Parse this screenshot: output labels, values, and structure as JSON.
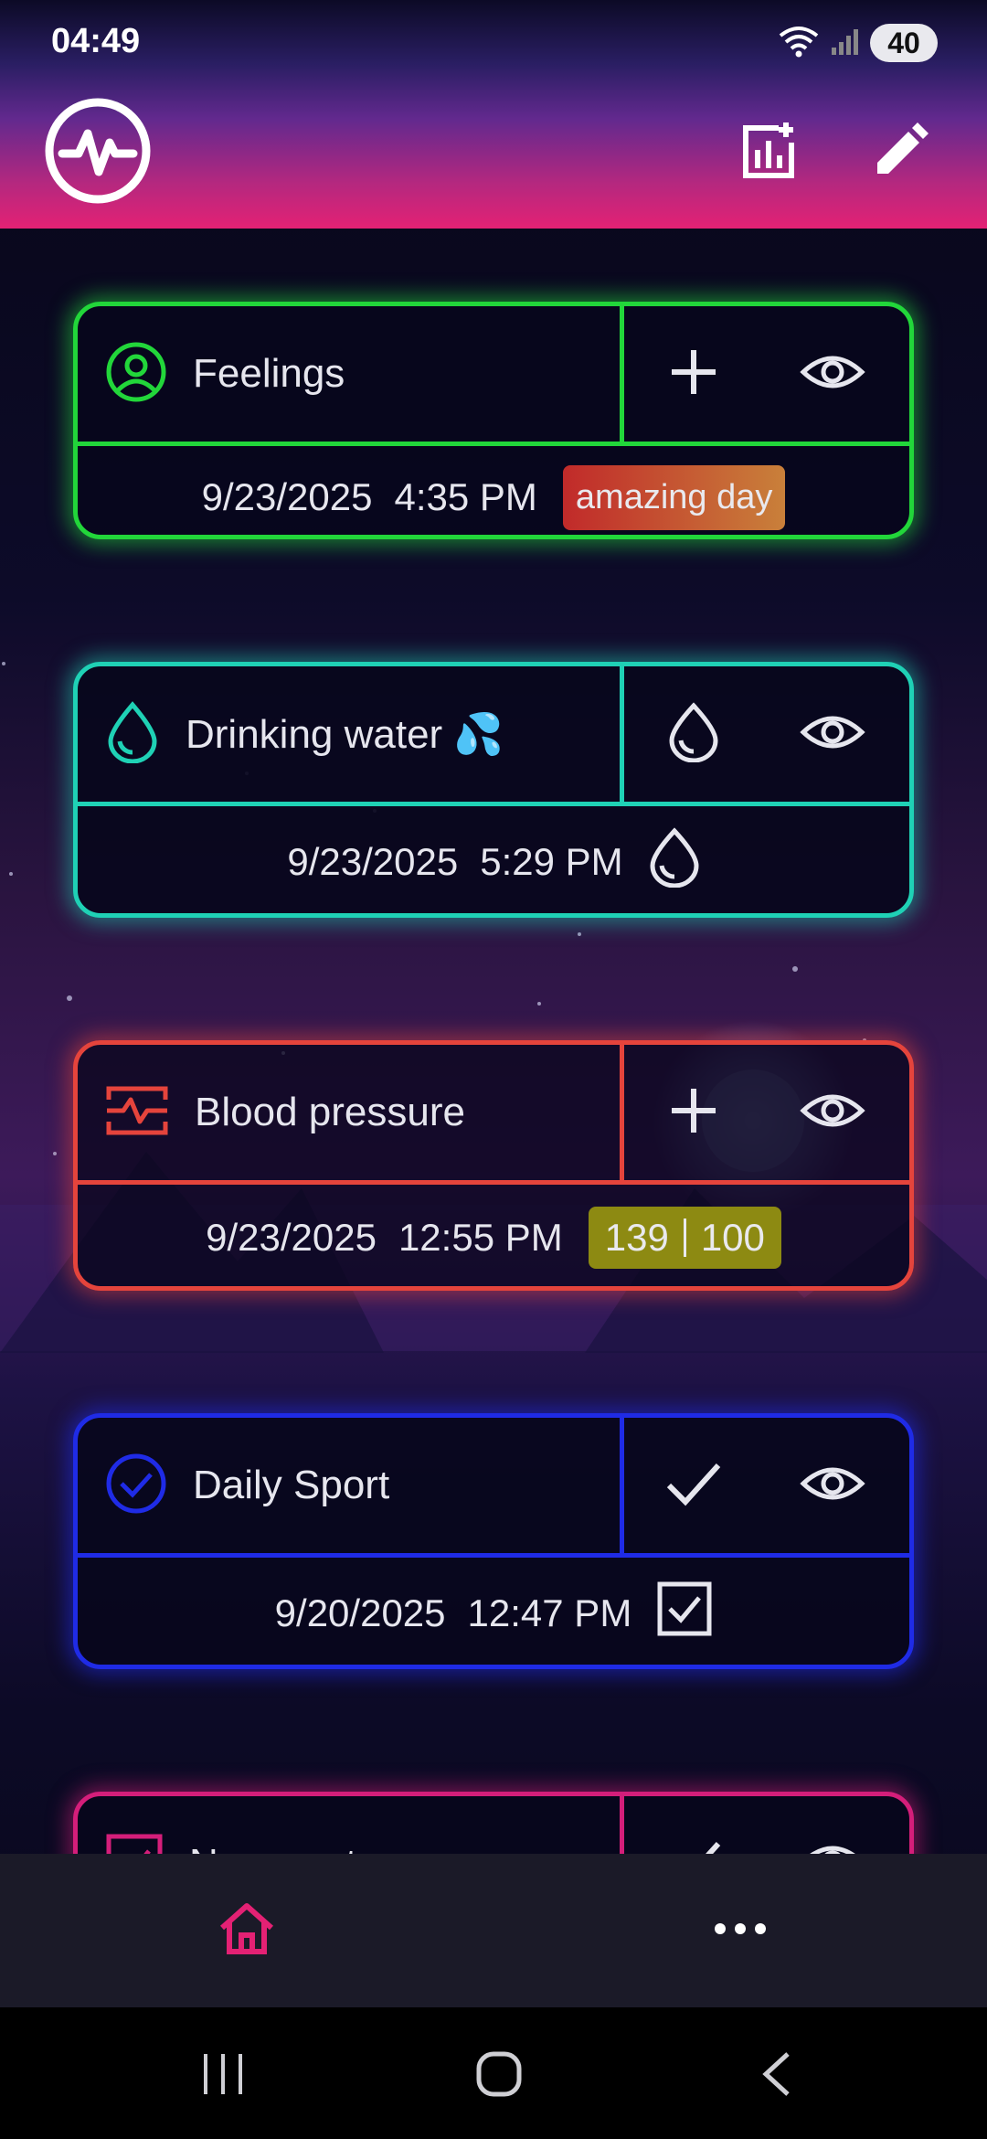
{
  "status_bar": {
    "time": "04:49",
    "battery": "40",
    "icons": [
      "wifi-icon",
      "signal-icon",
      "battery-icon"
    ]
  },
  "app_bar": {
    "logo_icon": "heartbeat-logo-icon",
    "actions": [
      "add-chart-icon",
      "edit-icon"
    ]
  },
  "trackers": [
    {
      "name": "Feelings",
      "icon": "person-circle-icon",
      "action_icon": "plus-icon",
      "view_icon": "eye-icon",
      "color": "#22d63a",
      "date": "9/23/2025",
      "time": "4:35 PM",
      "value": "amazing day"
    },
    {
      "name": "Drinking water 💦",
      "icon": "water-drop-icon",
      "action_icon": "water-drop-icon",
      "view_icon": "eye-icon",
      "color": "#1fd1b5",
      "date": "9/23/2025",
      "time": "5:29 PM",
      "value_icon": "water-drop-icon"
    },
    {
      "name": "Blood pressure",
      "icon": "monitor-heart-icon",
      "action_icon": "plus-icon",
      "view_icon": "eye-icon",
      "color": "#e5443c",
      "date": "9/23/2025",
      "time": "12:55 PM",
      "value_systolic": "139",
      "value_diastolic": "100"
    },
    {
      "name": "Daily Sport",
      "icon": "check-circle-icon",
      "action_icon": "check-icon",
      "view_icon": "eye-icon",
      "color": "#1f2be6",
      "date": "9/20/2025",
      "time": "12:47 PM",
      "value_icon": "checkbox-checked-icon"
    },
    {
      "name": "No sweets",
      "icon": "checkbox-icon",
      "action_icon": "check-icon",
      "view_icon": "eye-icon",
      "color": "#d41e7a"
    }
  ],
  "bottom_nav": {
    "items": [
      "home-icon",
      "more-icon"
    ],
    "active_color": "#e42174"
  },
  "system_nav": [
    "recents-icon",
    "home-circle-icon",
    "back-icon"
  ]
}
